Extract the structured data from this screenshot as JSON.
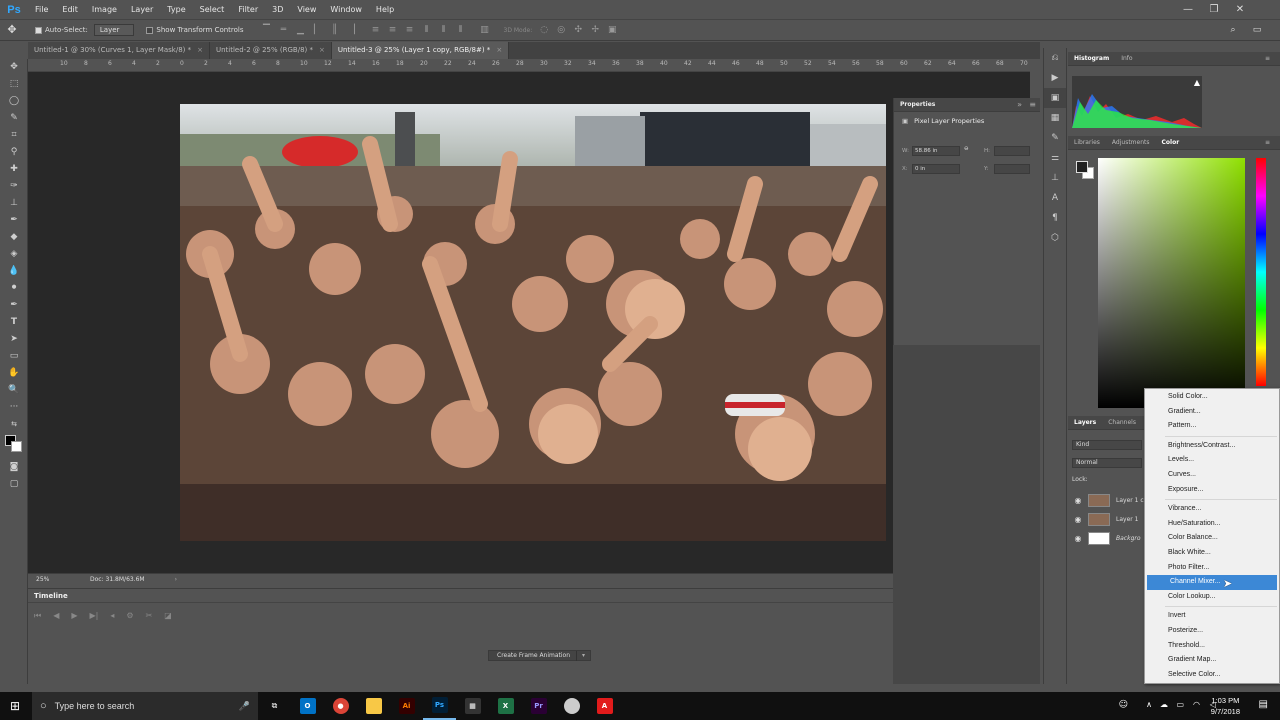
{
  "app": {
    "logo": "Ps"
  },
  "menubar": [
    "File",
    "Edit",
    "Image",
    "Layer",
    "Type",
    "Select",
    "Filter",
    "3D",
    "View",
    "Window",
    "Help"
  ],
  "options": {
    "auto_select": "Auto-Select:",
    "layer_select": "Layer",
    "show_transform": "Show Transform Controls",
    "mode_3d": "3D Mode:"
  },
  "tabs": [
    {
      "label": "Untitled-1 @ 30% (Curves 1, Layer Mask/8) *"
    },
    {
      "label": "Untitled-2 @ 25% (RGB/8) *"
    },
    {
      "label": "Untitled-3 @ 25% (Layer 1 copy, RGB/8#) *"
    }
  ],
  "ruler": [
    "10",
    "8",
    "6",
    "4",
    "2",
    "0",
    "2",
    "4",
    "6",
    "8",
    "10",
    "12",
    "14",
    "16",
    "18",
    "20",
    "22",
    "24",
    "26",
    "28",
    "30",
    "32",
    "34",
    "36",
    "38",
    "40",
    "42",
    "44",
    "46",
    "48",
    "50",
    "52",
    "54",
    "56",
    "58",
    "60",
    "62",
    "64",
    "66",
    "68",
    "70"
  ],
  "status": {
    "zoom": "25%",
    "doc": "Doc: 31.8M/63.6M"
  },
  "timeline": {
    "title": "Timeline",
    "create_button": "Create Frame Animation"
  },
  "properties": {
    "title": "Properties",
    "subtitle": "Pixel Layer Properties",
    "w_label": "W:",
    "w_value": "58.86 in",
    "h_label": "H:",
    "h_value": "",
    "x_label": "X:",
    "x_value": "0 in",
    "y_label": "Y:",
    "y_value": ""
  },
  "right_panels": {
    "histogram_tab": "Histogram",
    "info_tab": "Info",
    "libraries_tab": "Libraries",
    "adjustments_tab": "Adjustments",
    "color_tab": "Color",
    "layers_tab": "Layers",
    "channels_tab": "Channels",
    "kind_filter": "Kind",
    "blend_mode": "Normal",
    "lock_label": "Lock:"
  },
  "layers": [
    {
      "name": "Layer 1 c"
    },
    {
      "name": "Layer 1"
    },
    {
      "name": "Backgro"
    }
  ],
  "adjustment_menu": {
    "group1": [
      "Solid Color...",
      "Gradient...",
      "Pattern..."
    ],
    "group2": [
      "Brightness/Contrast...",
      "Levels...",
      "Curves...",
      "Exposure..."
    ],
    "group3": [
      "Vibrance...",
      "Hue/Saturation...",
      "Color Balance...",
      "Black  White...",
      "Photo Filter...",
      "Channel Mixer...",
      "Color Lookup..."
    ],
    "group4": [
      "Invert",
      "Posterize...",
      "Threshold...",
      "Gradient Map...",
      "Selective Color..."
    ],
    "highlighted": "Channel Mixer..."
  },
  "taskbar": {
    "search_placeholder": "Type here to search",
    "time": "1:03 PM",
    "date": "9/7/2018",
    "apps": [
      {
        "label": "Ai",
        "color": "#ff7c00"
      },
      {
        "label": "Ps",
        "color": "#31a8ff"
      },
      {
        "label": "X",
        "color": "#1e7145"
      },
      {
        "label": "Pr",
        "color": "#9999ff"
      },
      {
        "label": "A",
        "color": "#e21b1b"
      }
    ]
  }
}
